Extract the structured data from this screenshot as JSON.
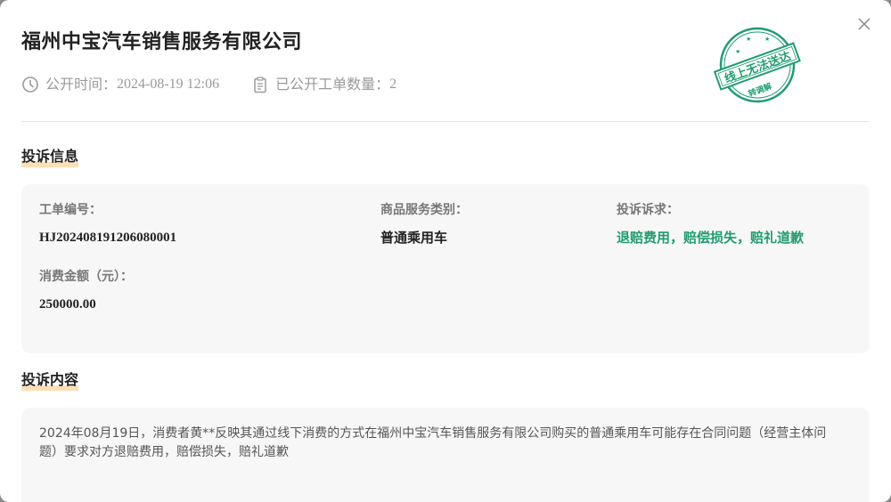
{
  "company_name": "福州中宝汽车销售服务有限公司",
  "meta": {
    "publish_label": "公开时间：",
    "publish_time": "2024-08-19 12:06",
    "count_label": "已公开工单数量：",
    "count_value": "2"
  },
  "stamp": {
    "main_text": "线上无法送达",
    "sub_text": "转调解",
    "color": "#1f9d6f"
  },
  "complaint_info": {
    "section_title": "投诉信息",
    "order_no_label": "工单编号：",
    "order_no": "HJ202408191206080001",
    "category_label": "商品服务类别：",
    "category": "普通乘用车",
    "demand_label": "投诉诉求：",
    "demand": "退赔费用，赔偿损失，赔礼道歉",
    "amount_label": "消费金额（元）：",
    "amount": "250000.00"
  },
  "complaint_content": {
    "section_title": "投诉内容",
    "text": "2024年08月19日，消费者黄**反映其通过线下消费的方式在福州中宝汽车销售服务有限公司购买的普通乘用车可能存在合同问题（经营主体问题）要求对方退赔费用，赔偿损失，赔礼道歉"
  },
  "colors": {
    "accent_green": "#1f9d6f",
    "title_underline": "#fde0b5"
  },
  "icons": {
    "close": "close-icon",
    "time": "clock-icon",
    "count": "clipboard-icon"
  }
}
